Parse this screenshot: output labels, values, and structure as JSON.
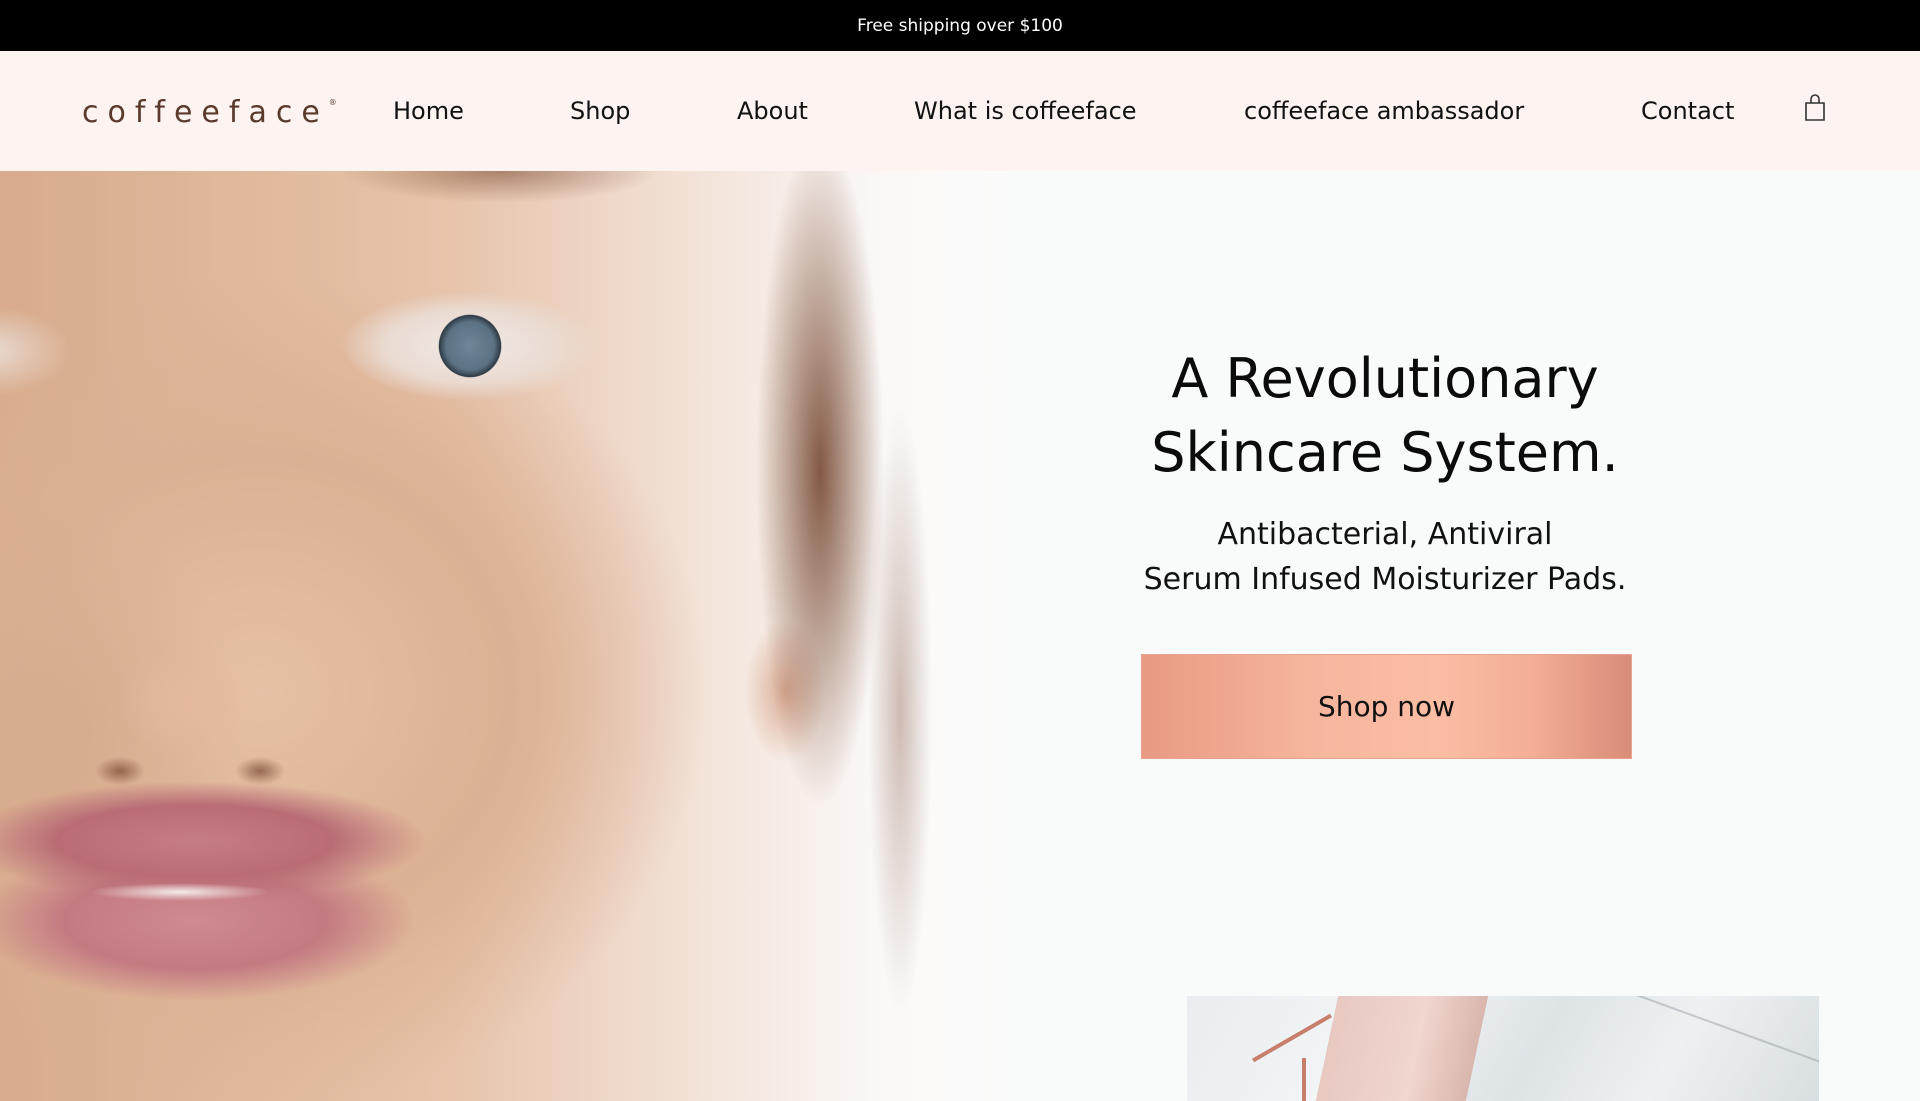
{
  "announcement": {
    "text": "Free shipping over $100"
  },
  "header": {
    "logo_text": "coffeeface",
    "logo_mark": "®",
    "nav": [
      {
        "label": "Home"
      },
      {
        "label": "Shop"
      },
      {
        "label": "About"
      },
      {
        "label": "What is coffeeface"
      },
      {
        "label": "coffeeface ambassador"
      },
      {
        "label": "Contact"
      }
    ],
    "cart_icon": "shopping-bag-icon"
  },
  "hero": {
    "headline": [
      "A Revolutionary",
      "Skincare System."
    ],
    "subline": [
      "Antibacterial, Antiviral",
      "Serum Infused Moisturizer Pads."
    ],
    "cta_label": "Shop now"
  },
  "colors": {
    "announcement_bg": "#000000",
    "header_bg": "#fdf4f2",
    "logo": "#5b3a2d",
    "cta_gradient_mid": "#fbbda4"
  }
}
